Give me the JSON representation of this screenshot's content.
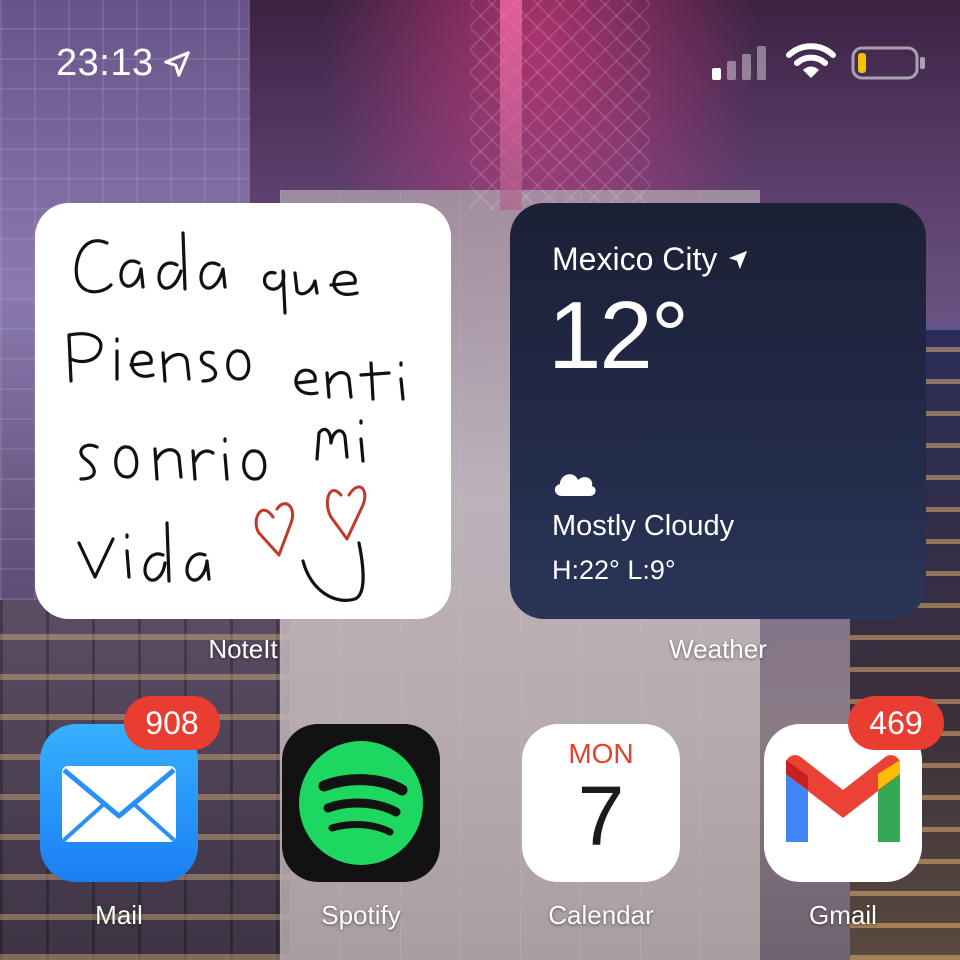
{
  "status_bar": {
    "time": "23:13",
    "location_icon": "location-arrow-icon",
    "signal_bars_filled": 1,
    "signal_bars_total": 4,
    "wifi_icon": "wifi-icon",
    "battery_level": 0.12,
    "battery_color": "#f2c400"
  },
  "widgets": {
    "noteit": {
      "label": "NoteIt",
      "handwriting_lines": [
        "Cada que",
        "Pienso en ti",
        "sonrio mi",
        "vida"
      ],
      "ink_color": "#111111",
      "heart_color": "#c0392b"
    },
    "weather": {
      "label": "Weather",
      "city": "Mexico City",
      "temperature": "12°",
      "condition": "Mostly Cloudy",
      "high_low": "H:22° L:9°",
      "condition_icon": "cloud-icon"
    }
  },
  "apps": [
    {
      "name": "Mail",
      "badge": "908",
      "icon": "mail-icon",
      "color": "#1a7ff2"
    },
    {
      "name": "Spotify",
      "badge": "",
      "icon": "spotify-icon",
      "color": "#1ed760"
    },
    {
      "name": "Calendar",
      "badge": "",
      "icon": "calendar-icon",
      "weekday": "MON",
      "day": "7"
    },
    {
      "name": "Gmail",
      "badge": "469",
      "icon": "gmail-icon"
    }
  ]
}
